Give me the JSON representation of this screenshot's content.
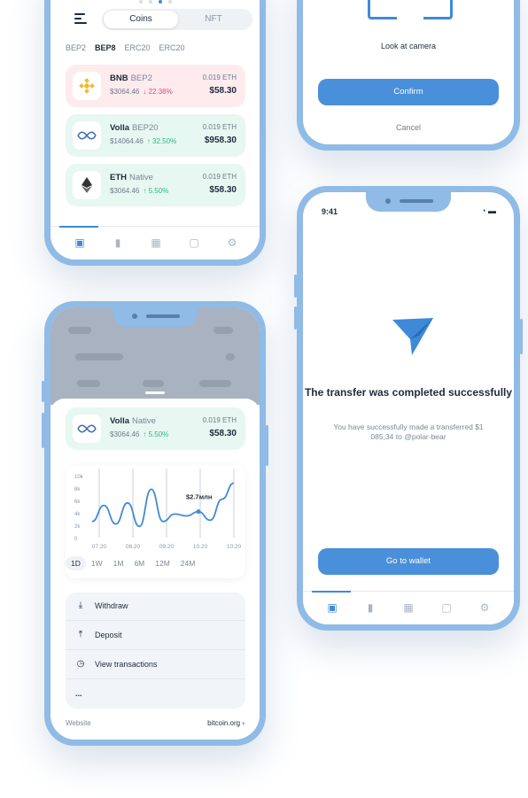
{
  "wallet": {
    "segments": [
      "Coins",
      "NFT"
    ],
    "chips": [
      "BEP2",
      "BEP8",
      "ERC20",
      "ERC20"
    ],
    "active_chip": "BEP8",
    "coins": [
      {
        "symbol": "BNB",
        "network": "BEP2",
        "price": "$3064.46",
        "change": "↓ 22.38%",
        "direction": "down",
        "amount": "0.019 ETH",
        "value": "$58.30",
        "bg": "#fdebee",
        "icon": "bnb-icon"
      },
      {
        "symbol": "Volla",
        "network": "BEP20",
        "price": "$14064.46",
        "change": "↑ 32.50%",
        "direction": "up",
        "amount": "0.019 ETH",
        "value": "$958.30",
        "bg": "#e7f7f1",
        "icon": "volla-icon"
      },
      {
        "symbol": "ETH",
        "network": "Native",
        "price": "$3064.46",
        "change": "↑ 5.50%",
        "direction": "up",
        "amount": "0.019 ETH",
        "value": "$58.30",
        "bg": "#e7f7f1",
        "icon": "eth-icon"
      }
    ]
  },
  "camera": {
    "hint": "Look at camera",
    "confirm": "Confirm",
    "cancel": "Cancel"
  },
  "success": {
    "time": "9:41",
    "title": "The transfer was completed successfully",
    "subtitle": "You have successfully made a transferred $1 085,34 to @polar-bear",
    "button": "Go to wallet"
  },
  "detail": {
    "coin": {
      "symbol": "Volla",
      "network": "Native",
      "price": "$3064.46",
      "change": "↑ 5.50%",
      "amount": "0.019 ETH",
      "value": "$58.30"
    },
    "ranges": [
      "1D",
      "1W",
      "1M",
      "6M",
      "12M",
      "24M"
    ],
    "selected_range": "1D",
    "actions": [
      "Withdraw",
      "Deposit",
      "View transactions",
      "..."
    ],
    "website_label": "Website",
    "website_value": "bitcoin.org"
  },
  "chart_data": {
    "type": "line",
    "x": [
      "07.20",
      "08.20",
      "09.20",
      "10.20",
      "10.20"
    ],
    "yticks": [
      "10k",
      "8k",
      "6k",
      "4k",
      "2k",
      "0"
    ],
    "ylim": [
      0,
      10
    ],
    "annotation": "$2.7млн",
    "series": [
      {
        "values": [
          2.6,
          5.2,
          2.2,
          5.6,
          1.8,
          7.8,
          2.6,
          3.8,
          3.5,
          4.2,
          2.8,
          6.2,
          8.8
        ]
      }
    ],
    "highlight_index": 9,
    "color": "#3f8ad8"
  },
  "colors": {
    "accent": "#4a8fd9",
    "frame": "#8fbbe6",
    "up": "#2cb88a",
    "down": "#e0506a"
  }
}
